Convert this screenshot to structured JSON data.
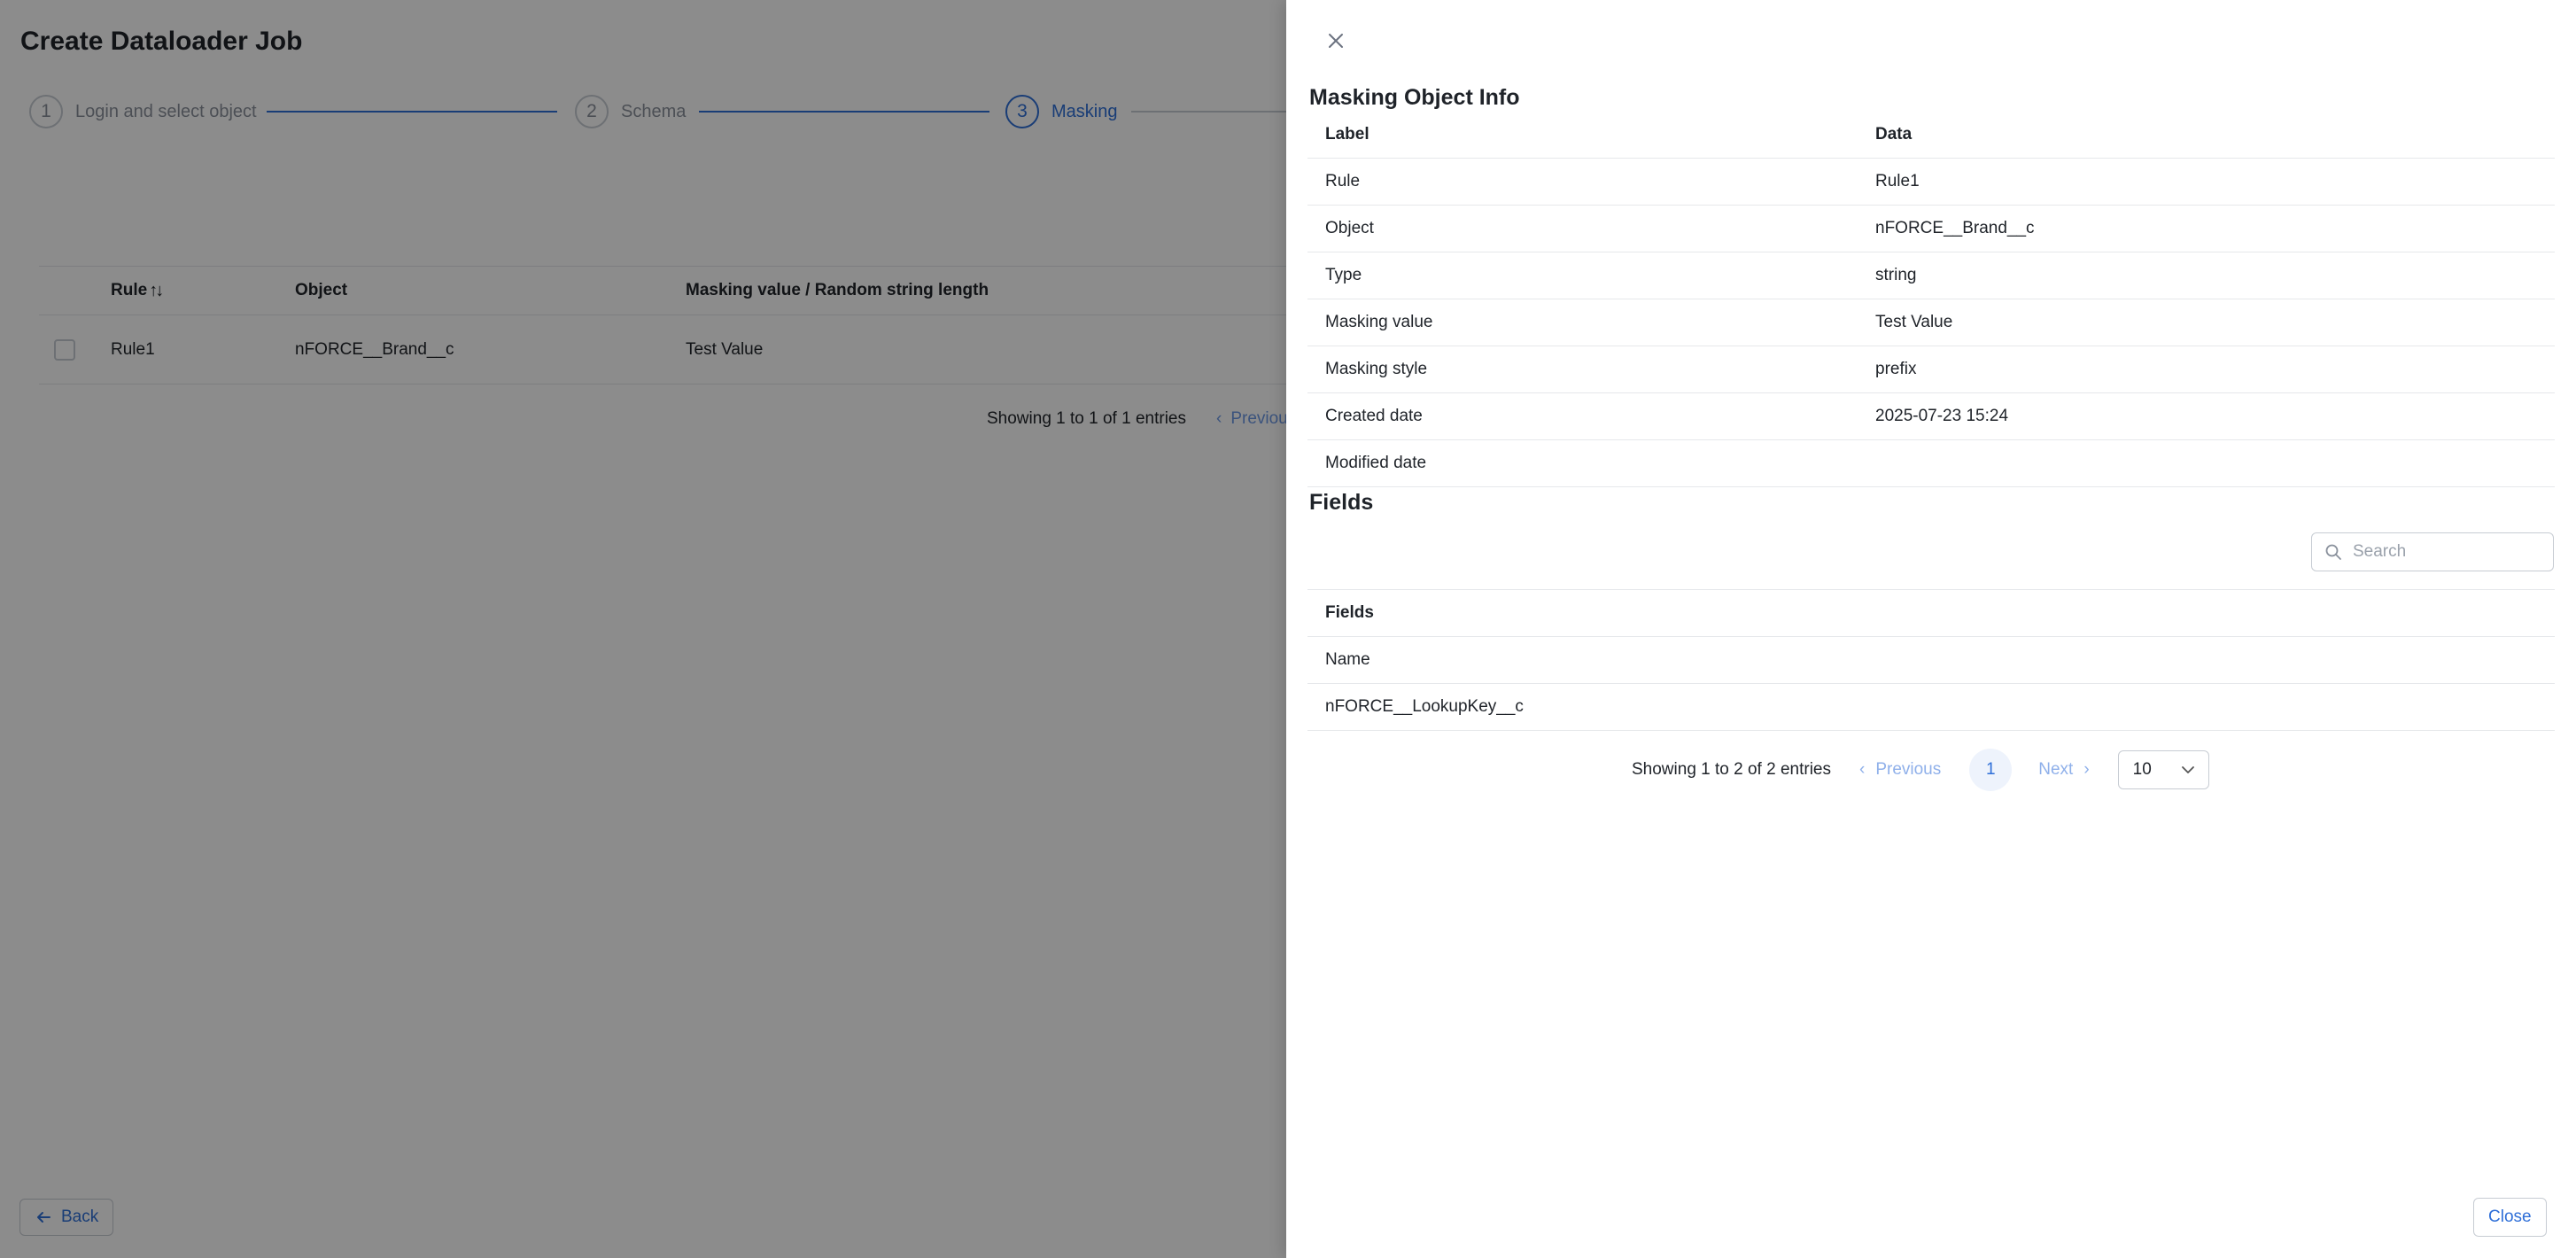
{
  "page": {
    "title": "Create Dataloader Job",
    "steps": [
      {
        "num": "1",
        "label": "Login and select object"
      },
      {
        "num": "2",
        "label": "Schema"
      },
      {
        "num": "3",
        "label": "Masking"
      }
    ],
    "table": {
      "headers": [
        "Rule",
        "Object",
        "Masking value / Random string length"
      ],
      "rows": [
        {
          "rule": "Rule1",
          "object": "nFORCE__Brand__c",
          "masking_value": "Test Value"
        }
      ]
    },
    "pagination": {
      "info": "Showing 1 to 1 of 1 entries",
      "previous": "Previous"
    },
    "back_label": "Back"
  },
  "drawer": {
    "info_title": "Masking Object Info",
    "info_headers": {
      "label": "Label",
      "data": "Data"
    },
    "info_rows": [
      {
        "label": "Rule",
        "data": "Rule1"
      },
      {
        "label": "Object",
        "data": "nFORCE__Brand__c"
      },
      {
        "label": "Type",
        "data": "string"
      },
      {
        "label": "Masking value",
        "data": "Test Value"
      },
      {
        "label": "Masking style",
        "data": "prefix"
      },
      {
        "label": "Created date",
        "data": "2025-07-23 15:24"
      },
      {
        "label": "Modified date",
        "data": ""
      }
    ],
    "fields_title": "Fields",
    "search_placeholder": "Search",
    "fields_header": "Fields",
    "fields_rows": [
      "Name",
      "nFORCE__LookupKey__c"
    ],
    "pagination": {
      "info": "Showing 1 to 2 of 2 entries",
      "previous": "Previous",
      "page": "1",
      "next": "Next",
      "page_size": "10"
    },
    "close_label": "Close"
  },
  "colors": {
    "accent": "#2f6fd8",
    "overlay": "rgba(0,0,0,0.45)"
  }
}
